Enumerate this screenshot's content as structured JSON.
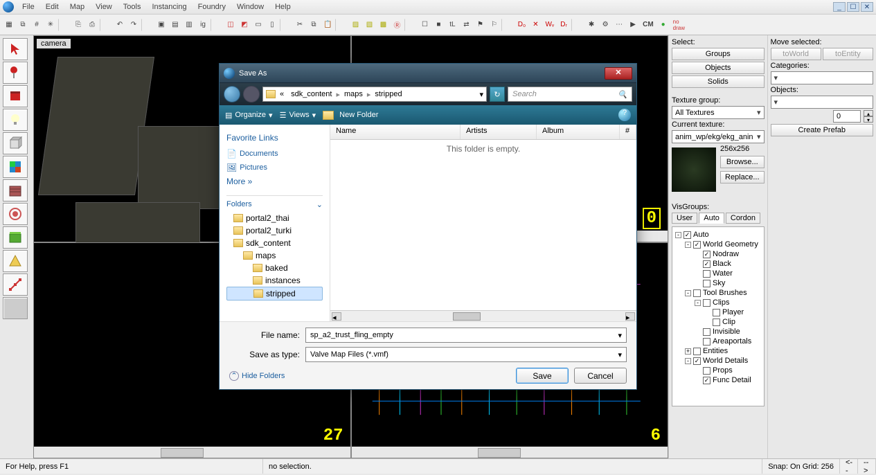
{
  "menu": [
    "File",
    "Edit",
    "Map",
    "View",
    "Tools",
    "Instancing",
    "Foundry",
    "Window",
    "Help"
  ],
  "winbtns": [
    "_",
    "☐",
    "✕"
  ],
  "viewport_label": "camera",
  "coord1": "27",
  "coord2": "6",
  "select_panel": {
    "title": "Select:",
    "buttons": [
      "Groups",
      "Objects",
      "Solids"
    ]
  },
  "texture_panel": {
    "group_label": "Texture group:",
    "group_value": "All Textures",
    "current_label": "Current texture:",
    "current_value": "anim_wp/ekg/ekg_anin",
    "size": "256x256",
    "browse": "Browse...",
    "replace": "Replace..."
  },
  "move_panel": {
    "title": "Move selected:",
    "toworld": "toWorld",
    "toentity": "toEntity",
    "categories_label": "Categories:",
    "objects_label": "Objects:",
    "prefab_value": "0",
    "create_prefab": "Create Prefab"
  },
  "visgroups": {
    "title": "VisGroups:",
    "tabs": [
      "User",
      "Auto",
      "Cordon"
    ],
    "tree": [
      {
        "indent": 0,
        "exp": "-",
        "chk": true,
        "label": "Auto"
      },
      {
        "indent": 1,
        "exp": "-",
        "chk": true,
        "label": "World Geometry"
      },
      {
        "indent": 2,
        "exp": "",
        "chk": true,
        "label": "Nodraw"
      },
      {
        "indent": 2,
        "exp": "",
        "chk": true,
        "label": "Black"
      },
      {
        "indent": 2,
        "exp": "",
        "chk": false,
        "label": "Water"
      },
      {
        "indent": 2,
        "exp": "",
        "chk": false,
        "label": "Sky"
      },
      {
        "indent": 1,
        "exp": "-",
        "chk": false,
        "label": "Tool Brushes"
      },
      {
        "indent": 2,
        "exp": "-",
        "chk": false,
        "label": "Clips"
      },
      {
        "indent": 3,
        "exp": "",
        "chk": false,
        "label": "Player"
      },
      {
        "indent": 3,
        "exp": "",
        "chk": false,
        "label": "Clip"
      },
      {
        "indent": 2,
        "exp": "",
        "chk": false,
        "label": "Invisible"
      },
      {
        "indent": 2,
        "exp": "",
        "chk": false,
        "label": "Areaportals"
      },
      {
        "indent": 1,
        "exp": "+",
        "chk": false,
        "label": "Entities"
      },
      {
        "indent": 1,
        "exp": "-",
        "chk": true,
        "label": "World Details"
      },
      {
        "indent": 2,
        "exp": "",
        "chk": false,
        "label": "Props"
      },
      {
        "indent": 2,
        "exp": "",
        "chk": true,
        "label": "Func Detail"
      }
    ]
  },
  "status": {
    "help": "For Help, press F1",
    "selection": "no selection.",
    "snap": "Snap: On Grid: 256"
  },
  "dialog": {
    "title": "Save As",
    "breadcrumb": [
      "«",
      "sdk_content",
      "maps",
      "stripped"
    ],
    "search_placeholder": "Search",
    "toolbar": {
      "organize": "Organize",
      "views": "Views",
      "newfolder": "New Folder"
    },
    "fav_header": "Favorite Links",
    "fav_links": [
      "Documents",
      "Pictures",
      "More »"
    ],
    "folders_header": "Folders",
    "folders": [
      {
        "indent": 0,
        "label": "portal2_thai"
      },
      {
        "indent": 0,
        "label": "portal2_turki"
      },
      {
        "indent": 0,
        "label": "sdk_content"
      },
      {
        "indent": 1,
        "label": "maps"
      },
      {
        "indent": 2,
        "label": "baked"
      },
      {
        "indent": 2,
        "label": "instances"
      },
      {
        "indent": 2,
        "label": "stripped",
        "sel": true
      }
    ],
    "columns": [
      "Name",
      "Artists",
      "Album",
      "#"
    ],
    "empty_text": "This folder is empty.",
    "filename_label": "File name:",
    "filename_value": "sp_a2_trust_fling_empty",
    "type_label": "Save as type:",
    "type_value": "Valve Map Files (*.vmf)",
    "hide_folders": "Hide Folders",
    "save": "Save",
    "cancel": "Cancel"
  }
}
